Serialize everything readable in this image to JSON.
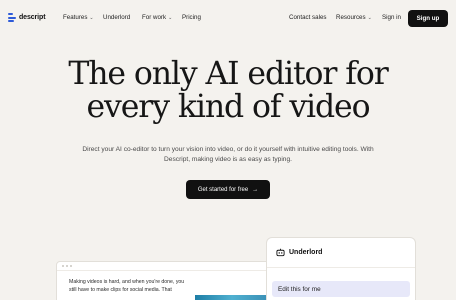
{
  "brand": {
    "name": "descript",
    "accent": "#2d5bd8"
  },
  "nav": {
    "items": [
      {
        "label": "Features",
        "dropdown": true
      },
      {
        "label": "Underlord",
        "dropdown": false
      },
      {
        "label": "For work",
        "dropdown": true
      },
      {
        "label": "Pricing",
        "dropdown": false
      }
    ],
    "right": [
      {
        "label": "Contact sales",
        "dropdown": false
      },
      {
        "label": "Resources",
        "dropdown": true
      },
      {
        "label": "Sign in",
        "dropdown": false
      }
    ],
    "signup_label": "Sign up"
  },
  "hero": {
    "headline_line1": "The only AI editor for",
    "headline_line2": "every kind of video",
    "subtitle_line1": "Direct your AI co-editor to turn your vision into video, or do it yourself with intuitive editing tools. With",
    "subtitle_line2": "Descript, making video is as easy as typing.",
    "cta_label": "Get started for free",
    "cta_icon": "arrow-right-icon"
  },
  "preview": {
    "text_line1": "Making videos is hard, and when you're done, you",
    "text_line2": "still have to make clips for social media. That"
  },
  "underlord_panel": {
    "title": "Underlord",
    "icon": "robot-icon",
    "suggestion": "Edit this for me"
  }
}
